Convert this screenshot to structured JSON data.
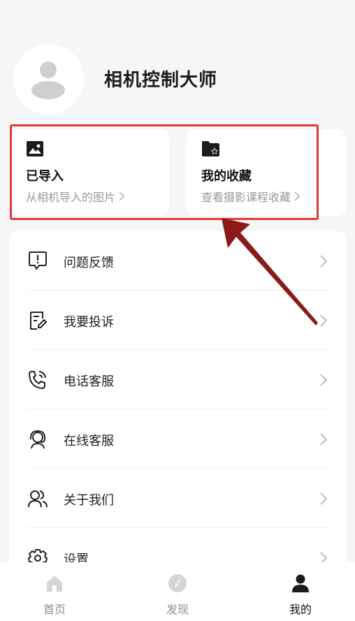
{
  "header": {
    "app_name": "相机控制大师"
  },
  "cards": [
    {
      "title": "已导入",
      "subtitle": "从相机导入的图片",
      "icon": "image-icon"
    },
    {
      "title": "我的收藏",
      "subtitle": "查看摄影课程收藏",
      "icon": "folder-star-icon"
    }
  ],
  "menu": [
    {
      "label": "问题反馈",
      "icon": "feedback-icon"
    },
    {
      "label": "我要投诉",
      "icon": "complaint-icon"
    },
    {
      "label": "电话客服",
      "icon": "phone-icon"
    },
    {
      "label": "在线客服",
      "icon": "headset-icon"
    },
    {
      "label": "关于我们",
      "icon": "users-icon"
    },
    {
      "label": "设置",
      "icon": "gear-icon"
    }
  ],
  "tabs": [
    {
      "label": "首页",
      "icon": "home-icon",
      "active": false
    },
    {
      "label": "发现",
      "icon": "compass-icon",
      "active": false
    },
    {
      "label": "我的",
      "icon": "person-icon",
      "active": true
    }
  ],
  "colors": {
    "highlight": "#e2393b",
    "annotation_arrow": "#8b1a1a"
  }
}
